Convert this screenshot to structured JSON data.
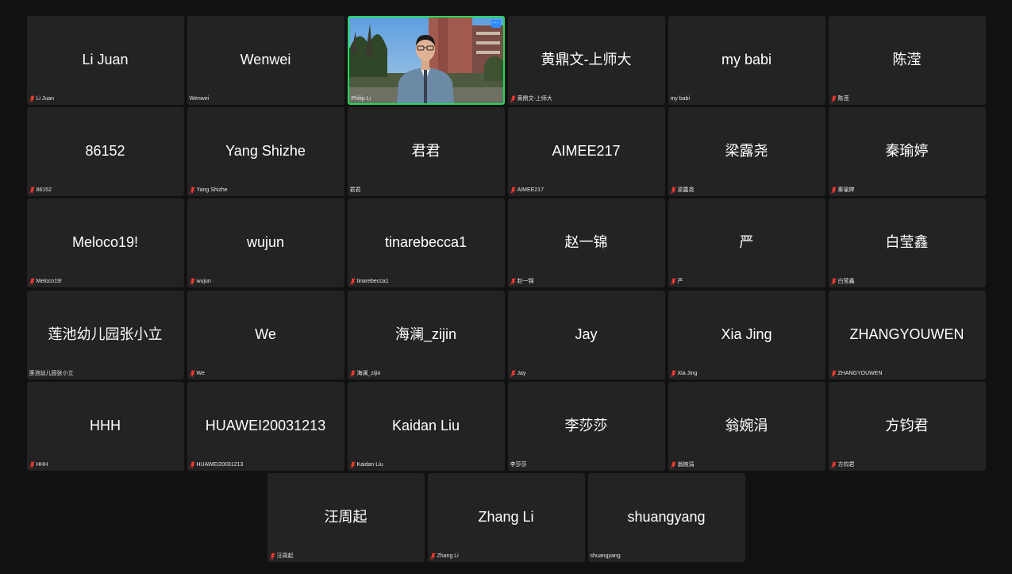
{
  "accent_color": "#23d959",
  "more_button_color": "#2d8cff",
  "rows": [
    [
      {
        "name": "Li Juan",
        "label": "Li Juan",
        "muted": true
      },
      {
        "name": "Wenwei",
        "label": "Wenwei",
        "muted": false
      },
      {
        "name": "",
        "label": "Philip Li",
        "muted": false,
        "video": true,
        "more": "···"
      },
      {
        "name": "黄鼎文-上师大",
        "label": "黄鼎文-上师大",
        "muted": true
      },
      {
        "name": "my babi",
        "label": "my babi",
        "muted": false
      },
      {
        "name": "陈滢",
        "label": "陈滢",
        "muted": true
      }
    ],
    [
      {
        "name": "86152",
        "label": "86152",
        "muted": true
      },
      {
        "name": "Yang Shizhe",
        "label": "Yang Shizhe",
        "muted": true
      },
      {
        "name": "君君",
        "label": "君君",
        "muted": false
      },
      {
        "name": "AIMEE217",
        "label": "AIMEE217",
        "muted": true
      },
      {
        "name": "梁露尧",
        "label": "梁露尧",
        "muted": true
      },
      {
        "name": "秦瑜婷",
        "label": "秦瑜婷",
        "muted": true
      }
    ],
    [
      {
        "name": "Meloco19!",
        "label": "Meloco19!",
        "muted": true
      },
      {
        "name": "wujun",
        "label": "wujun",
        "muted": true
      },
      {
        "name": "tinarebecca1",
        "label": "tinarebecca1",
        "muted": true
      },
      {
        "name": "赵一锦",
        "label": "赵一锦",
        "muted": true
      },
      {
        "name": "严",
        "label": "严",
        "muted": true
      },
      {
        "name": "白莹鑫",
        "label": "白莹鑫",
        "muted": true
      }
    ],
    [
      {
        "name": "莲池幼儿园张小立",
        "label": "莲池幼儿园张小立",
        "muted": false
      },
      {
        "name": "We",
        "label": "We",
        "muted": true
      },
      {
        "name": "海澜_zijin",
        "label": "海澜_zijin",
        "muted": true
      },
      {
        "name": "Jay",
        "label": "Jay",
        "muted": true
      },
      {
        "name": "Xia Jing",
        "label": "Xia Jing",
        "muted": true
      },
      {
        "name": "ZHANGYOUWEN",
        "label": "ZHANGYOUWEN",
        "muted": true
      }
    ],
    [
      {
        "name": "HHH",
        "label": "HHH",
        "muted": true
      },
      {
        "name": "HUAWEI20031213",
        "label": "HUAWEI20031213",
        "muted": true
      },
      {
        "name": "Kaidan Liu",
        "label": "Kaidan Liu",
        "muted": true
      },
      {
        "name": "李莎莎",
        "label": "李莎莎",
        "muted": false
      },
      {
        "name": "翁婉涓",
        "label": "翁婉涓",
        "muted": true
      },
      {
        "name": "方钧君",
        "label": "方钧君",
        "muted": true
      }
    ],
    [
      {
        "name": "汪周起",
        "label": "汪周起",
        "muted": true
      },
      {
        "name": "Zhang Li",
        "label": "Zhang Li",
        "muted": true
      },
      {
        "name": "shuangyang",
        "label": "shuangyang",
        "muted": false
      }
    ]
  ]
}
